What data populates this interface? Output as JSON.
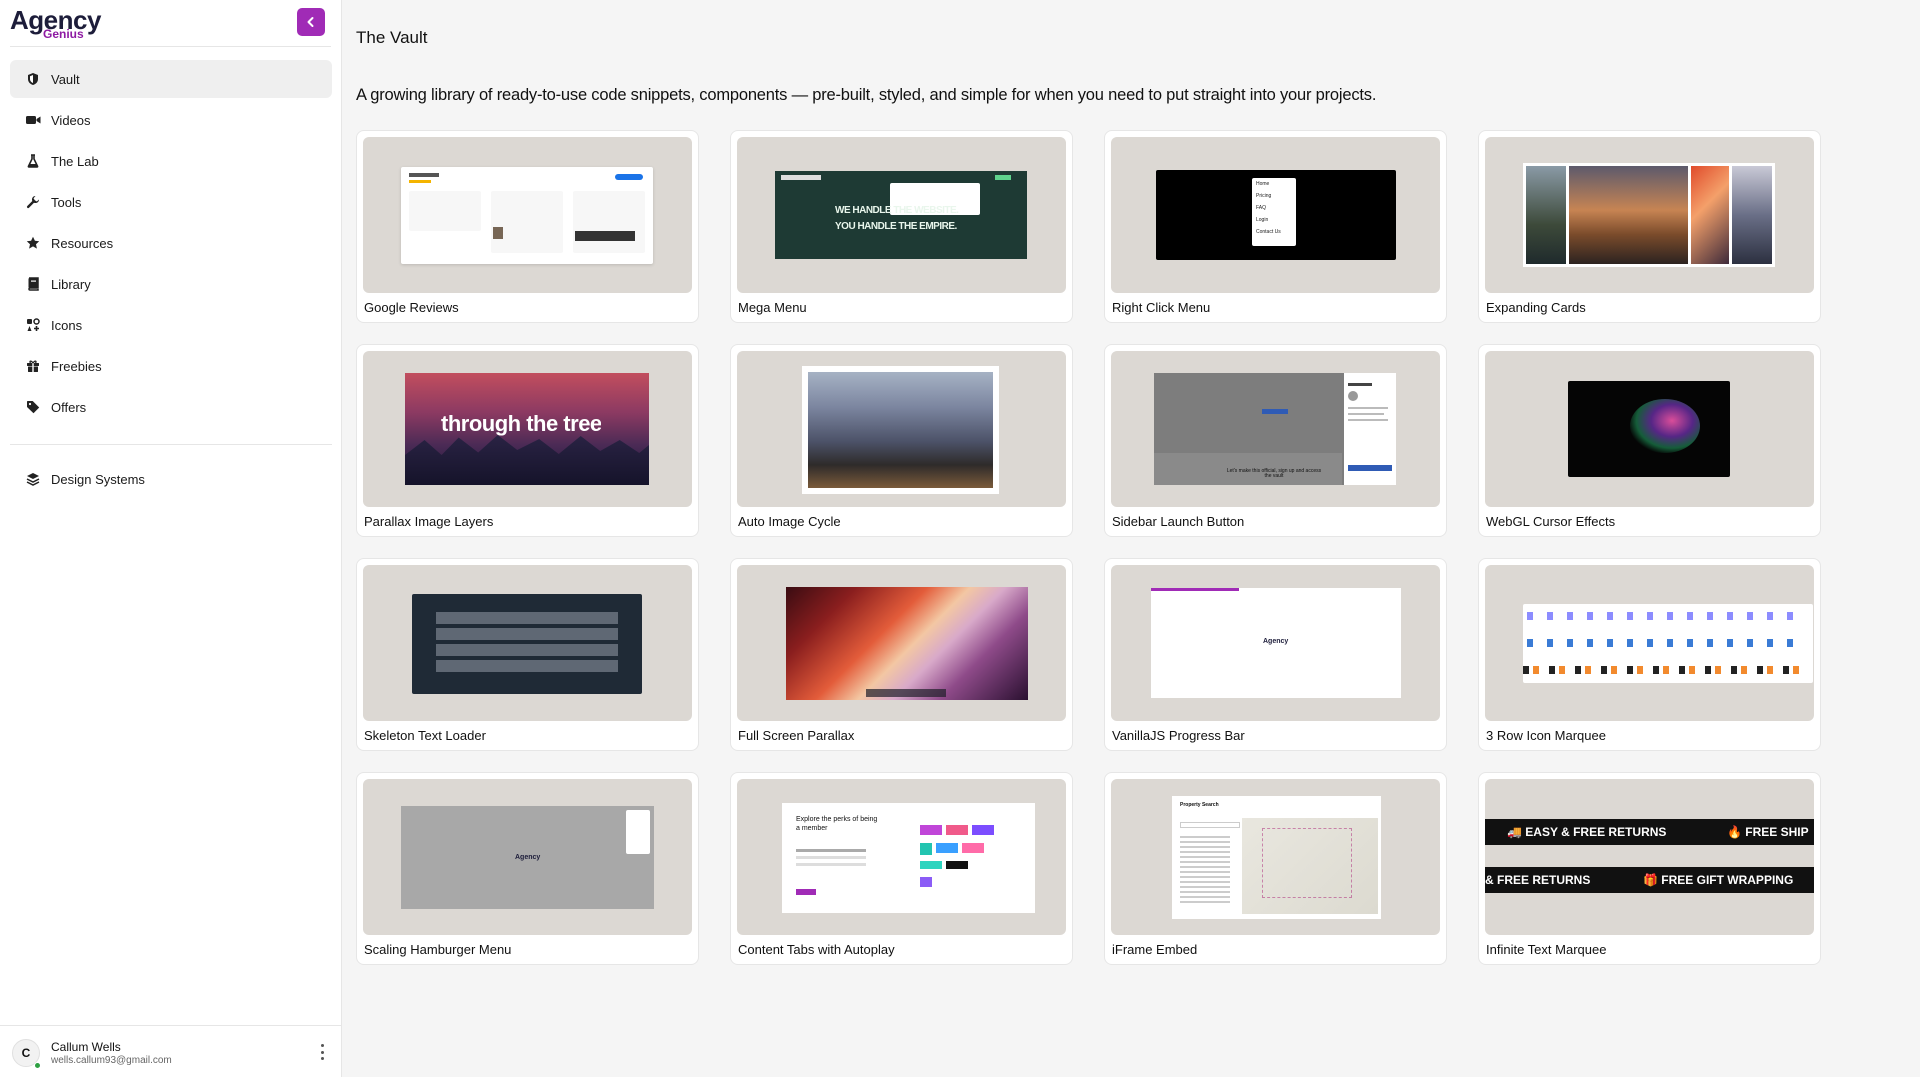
{
  "brand": {
    "name": "Agency",
    "sub": "Genius"
  },
  "nav": {
    "items": [
      {
        "label": "Vault",
        "icon": "shield-icon",
        "active": true
      },
      {
        "label": "Videos",
        "icon": "video-camera-icon"
      },
      {
        "label": "The Lab",
        "icon": "flask-icon"
      },
      {
        "label": "Tools",
        "icon": "wrench-icon"
      },
      {
        "label": "Resources",
        "icon": "star-icon"
      },
      {
        "label": "Library",
        "icon": "book-icon"
      },
      {
        "label": "Icons",
        "icon": "icons-grid-icon"
      },
      {
        "label": "Freebies",
        "icon": "gift-icon"
      },
      {
        "label": "Offers",
        "icon": "tag-icon"
      }
    ],
    "secondary": [
      {
        "label": "Design Systems",
        "icon": "layers-icon"
      }
    ]
  },
  "user": {
    "initial": "C",
    "name": "Callum Wells",
    "email": "wells.callum93@gmail.com"
  },
  "page": {
    "title": "The Vault",
    "description": "A growing library of ready-to-use code snippets, components — pre-built, styled, and simple for when you need to put straight into your projects."
  },
  "cards": [
    {
      "label": "Google Reviews"
    },
    {
      "label": "Mega Menu"
    },
    {
      "label": "Right Click Menu"
    },
    {
      "label": "Expanding Cards"
    },
    {
      "label": "Parallax Image Layers"
    },
    {
      "label": "Auto Image Cycle"
    },
    {
      "label": "Sidebar Launch Button"
    },
    {
      "label": "WebGL Cursor Effects"
    },
    {
      "label": "Skeleton Text Loader"
    },
    {
      "label": "Full Screen Parallax"
    },
    {
      "label": "VanillaJS Progress Bar"
    },
    {
      "label": "3 Row Icon Marquee"
    },
    {
      "label": "Scaling Hamburger Menu"
    },
    {
      "label": "Content Tabs with Autoplay"
    },
    {
      "label": "iFrame Embed"
    },
    {
      "label": "Infinite Text Marquee"
    }
  ],
  "previews": {
    "mega_menu": {
      "headline1": "WE HANDLE THE WEBSITE.",
      "headline2": "YOU HANDLE THE EMPIRE."
    },
    "right_click_menu": {
      "items": [
        "Home",
        "Pricing",
        "FAQ",
        "Login",
        "Contact Us"
      ]
    },
    "parallax": {
      "text": "through the trees"
    },
    "sidebar_launch": {
      "text": "Let's make this official, sign up and access the vault"
    },
    "hamburger": {
      "logo": "Agency"
    },
    "progress_bar": {
      "logo": "Agency"
    },
    "content_tabs": {
      "heading": "Explore the perks of being a member"
    },
    "iframe": {
      "heading": "Property Search"
    },
    "text_marquee": {
      "row1": [
        "🚚 EASY & FREE RETURNS",
        "🔥 FREE SHIP"
      ],
      "row2": [
        "& FREE RETURNS",
        "🎁 FREE GIFT WRAPPING"
      ]
    }
  },
  "colors": {
    "accent": "#a02bb6",
    "thumb_bg": "#dcd8d3",
    "active_nav": "#efefef"
  }
}
